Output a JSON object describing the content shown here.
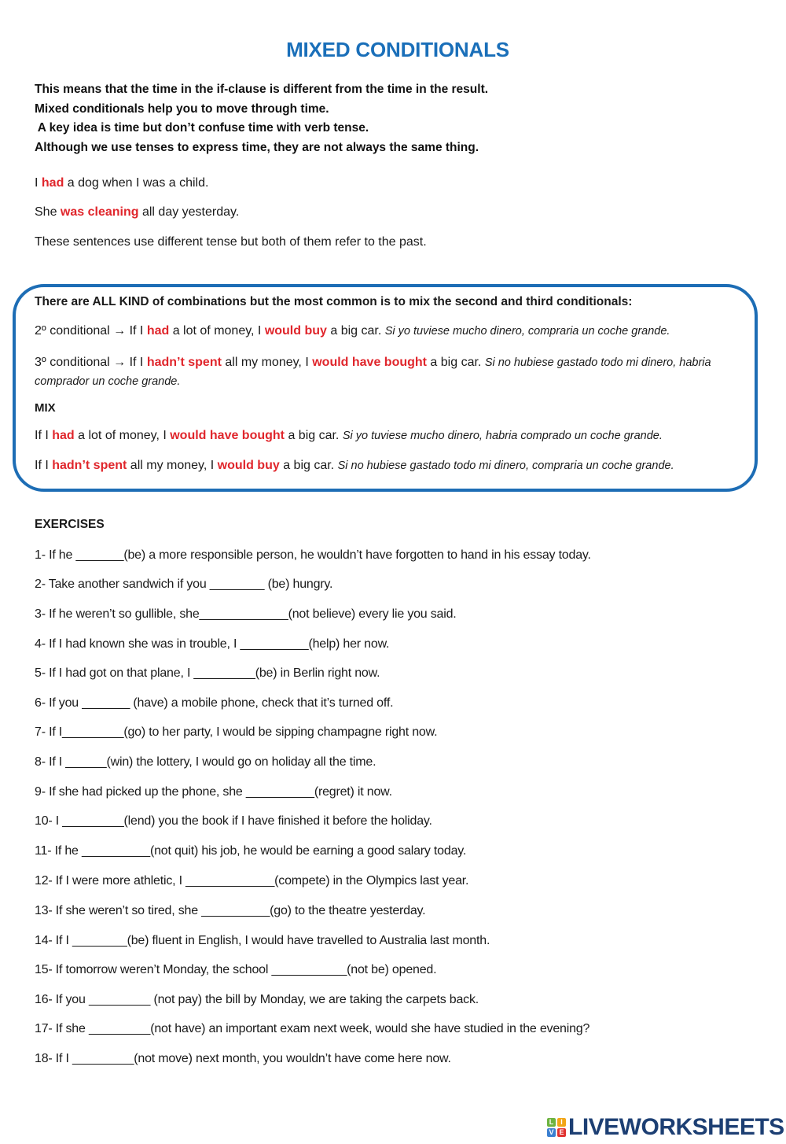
{
  "title": "MIXED CONDITIONALS",
  "intro": [
    "This means that the time in the if-clause is different from the time in the result.",
    "Mixed conditionals help you to move through time.",
    " A key idea is time but don’t confuse time with verb tense.",
    "Although we use tenses to express time, they are not always the same thing."
  ],
  "examples": {
    "s1": {
      "a": "I ",
      "r": "had",
      "b": " a dog when I was a child."
    },
    "s2": {
      "a": "She ",
      "r": "was cleaning",
      "b": " all day yesterday."
    },
    "s3": "These sentences use different tense but both of them refer to the past."
  },
  "box": {
    "heading": "There are ALL KIND of combinations but the most common is to mix the second and third conditionals:",
    "second": {
      "a": "2º conditional → If I ",
      "r1": "had",
      "b": " a lot of money, I ",
      "r2": "would buy",
      "c": " a big car. ",
      "es": "Si yo tuviese mucho dinero, compraria un coche grande."
    },
    "third": {
      "a": "3º conditional → If I ",
      "r1": "hadn’t spent",
      "b": " all my money, I ",
      "r2": "would have bought",
      "c": " a big car. ",
      "es": "Si no hubiese gastado todo mi dinero, habria comprador un coche grande."
    },
    "mix_label": "MIX",
    "mix1": {
      "a": "If I ",
      "r1": "had",
      "b": " a lot of money, I ",
      "r2": "would have bought",
      "c": " a big car. ",
      "es": "Si yo tuviese mucho dinero, habria comprado un coche grande."
    },
    "mix2": {
      "a": "If I ",
      "r1": "hadn’t spent",
      "b": " all my money, I ",
      "r2": "would buy",
      "c": " a big car. ",
      "es": "Si no hubiese gastado todo mi dinero, compraria un coche grande."
    }
  },
  "exercises_heading": "EXERCISES",
  "exercises": [
    "1- If he _______(be) a more responsible person, he wouldn’t have forgotten to hand in his essay today.",
    "2- Take another sandwich if you ________ (be) hungry.",
    "3- If he weren’t so gullible, she_____________(not believe) every lie you said.",
    "4- If I had known she was in trouble, I __________(help) her now.",
    "5- If I had got on that plane, I _________(be) in Berlin right now.",
    "6- If you _______ (have) a mobile phone, check that it’s turned off.",
    "7- If I_________(go) to her party, I would be sipping champagne right now.",
    "8- If I ______(win) the lottery, I would go on holiday all the time.",
    "9- If she had picked up the phone, she __________(regret) it now.",
    "10- I _________(lend) you the book if I have finished it before the holiday.",
    "11- If he __________(not quit) his job, he would be earning a good salary today.",
    "12- If I were more athletic, I _____________(compete) in the Olympics last year.",
    "13- If she weren’t so tired, she __________(go) to the theatre yesterday.",
    "14- If I ________(be) fluent in English, I would have travelled to Australia last month.",
    "15- If tomorrow weren’t Monday, the school ___________(not be) opened.",
    "16- If you _________ (not pay) the bill by Monday, we are taking the carpets back.",
    "17- If she _________(not have) an important exam next week, would she have studied in the evening?",
    "18- If I _________(not move) next month, you wouldn’t have come here now."
  ],
  "logo": {
    "tiles": [
      "L",
      "I",
      "V",
      "E"
    ],
    "tile_colors": [
      "#6cb33f",
      "#f2a516",
      "#3a7fd0",
      "#e0312f"
    ],
    "text": "LIVEWORKSHEETS",
    "text_color": "#1d3f73"
  },
  "colors": {
    "title": "#1a6fb9",
    "highlight": "#e0262c",
    "box_border": "#1d6db5"
  }
}
